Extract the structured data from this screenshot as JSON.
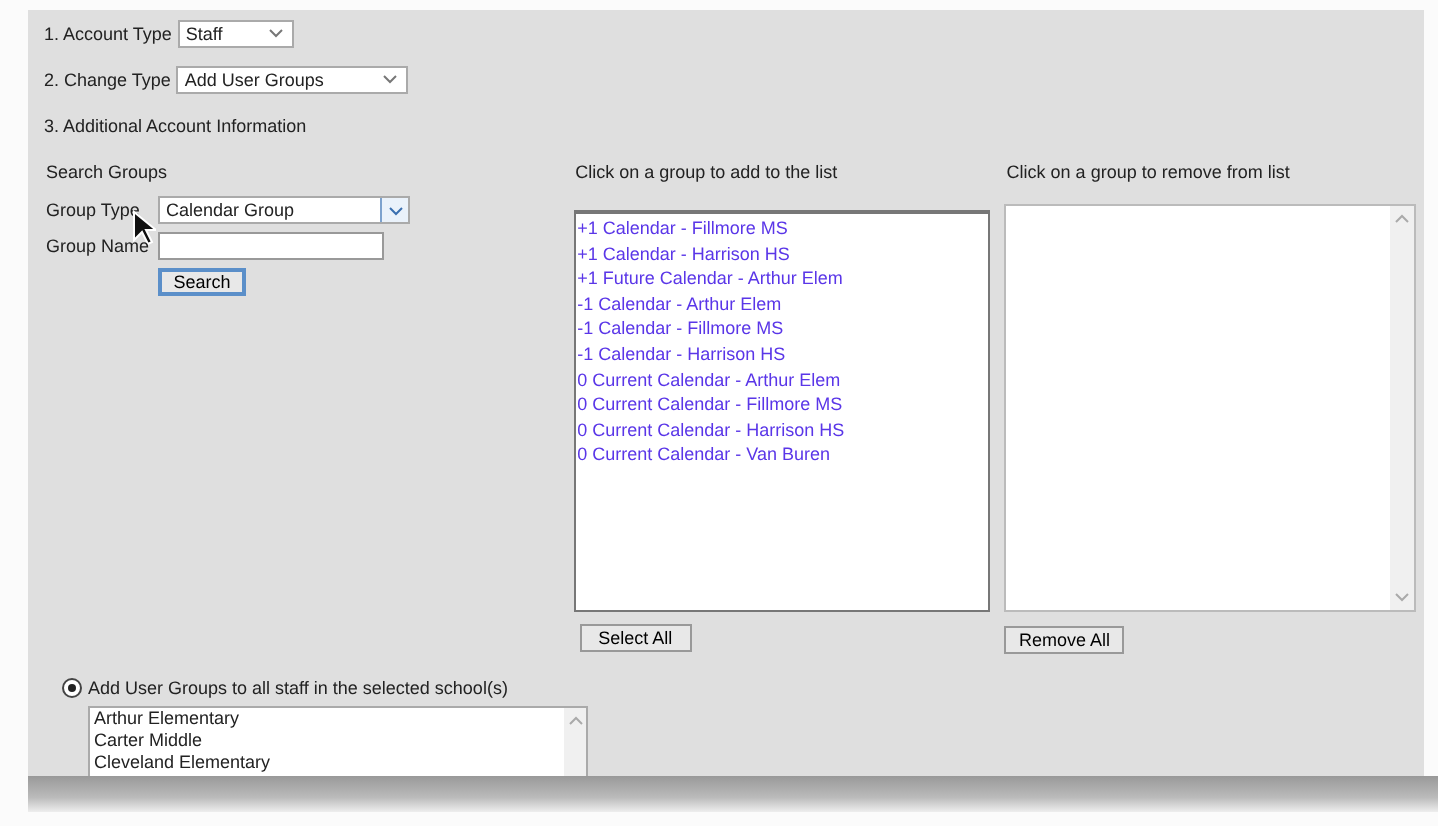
{
  "account_type": {
    "label": "1. Account Type",
    "value": "Staff"
  },
  "change_type": {
    "label": "2. Change Type",
    "value": "Add User Groups"
  },
  "section_title": "3. Additional Account Information",
  "search": {
    "heading": "Search Groups",
    "group_type_label": "Group Type",
    "group_type_value": "Calendar Group",
    "group_name_label": "Group Name",
    "button": "Search"
  },
  "add_list": {
    "heading": "Click on a group to add to the list",
    "items": [
      "+1 Calendar - Fillmore MS",
      "+1 Calendar - Harrison HS",
      "+1 Future Calendar - Arthur Elem",
      "-1 Calendar - Arthur Elem",
      "-1 Calendar - Fillmore MS",
      "-1 Calendar - Harrison HS",
      "0 Current Calendar - Arthur Elem",
      "0 Current Calendar - Fillmore MS",
      "0 Current Calendar - Harrison HS",
      "0 Current Calendar - Van Buren"
    ],
    "button": "Select All"
  },
  "remove_list": {
    "heading": "Click on a group to remove from list",
    "button": "Remove All"
  },
  "schools_option": {
    "label": "Add User Groups to all staff in the selected school(s)",
    "selected": true
  },
  "schools": [
    "Arthur Elementary",
    "Carter Middle",
    "Cleveland Elementary"
  ]
}
